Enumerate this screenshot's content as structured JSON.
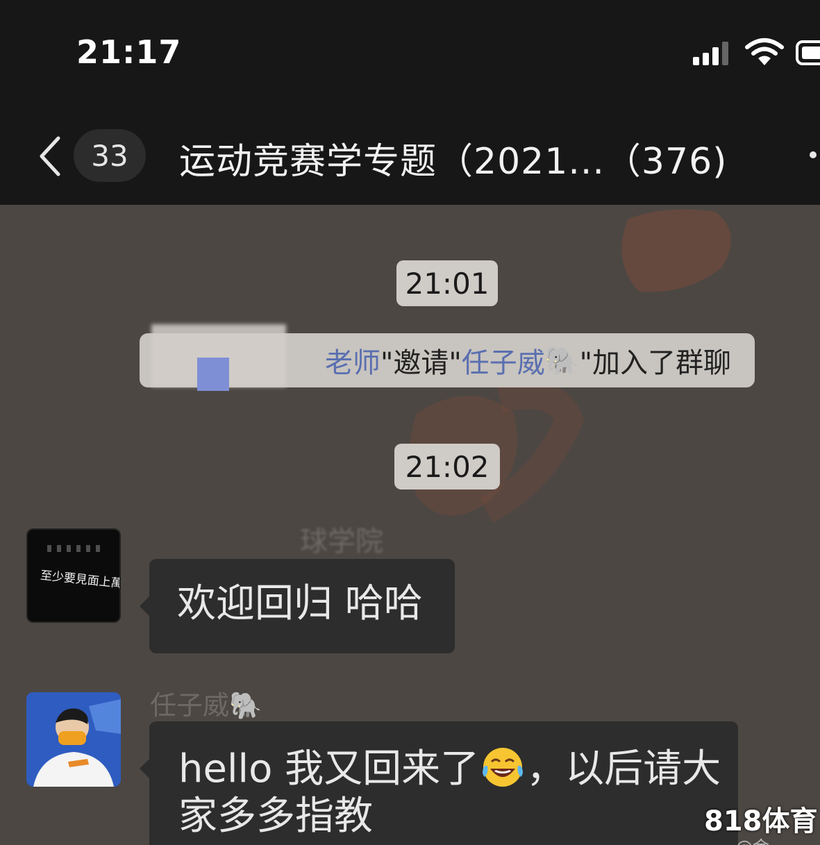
{
  "status_bar": {
    "time": "21:17",
    "icons": [
      "signal-icon",
      "wifi-icon",
      "battery-icon"
    ]
  },
  "nav": {
    "back_icon": "chevron-left-icon",
    "unread_count": "33",
    "title": "运动竞赛学专题（2021...（376)",
    "more_icon": "more-dots-icon"
  },
  "messages": {
    "time_1": "21:01",
    "system": {
      "prefix": "老师",
      "verb": "\"邀请\"",
      "invitee": "任子威",
      "invitee_emoji": "🐘",
      "suffix": "\"加入了群聊"
    },
    "time_2": "21:02",
    "msg1": {
      "sender": "球学院",
      "avatar_caption": "至少要見面上萬次",
      "text": "欢迎回归 哈哈"
    },
    "msg2": {
      "sender": "任子威",
      "sender_emoji": "🐘",
      "line1_a": "hello 我又回来了",
      "line1_b": "，以后请大",
      "line2": "家多多指教",
      "emoji": "tears-of-joy-emoji"
    }
  },
  "watermark": {
    "text": "818体育",
    "sub": "@金"
  },
  "colors": {
    "header_bg": "#171717",
    "chat_bg": "#4c4743",
    "bubble_bg": "#2d2d2d",
    "time_pill_bg": "#cfcbc6",
    "link_blue": "#5a6fb0"
  }
}
